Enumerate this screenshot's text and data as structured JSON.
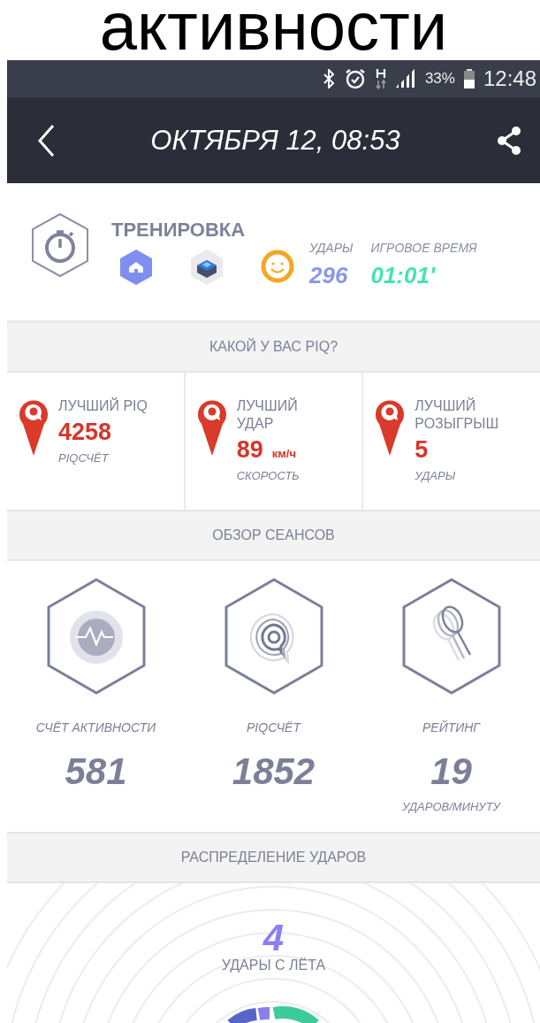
{
  "caption": "активности",
  "status_bar": {
    "battery": "33%",
    "time": "12:48"
  },
  "app_bar": {
    "title": "ОКТЯБРЯ 12, 08:53"
  },
  "workout": {
    "title": "ТРЕНИРОВКА",
    "stats": [
      {
        "label": "УДАРЫ",
        "value": "296",
        "color": "#8b98e6"
      },
      {
        "label": "ИГРОВОЕ ВРЕМЯ",
        "value": "01:01'",
        "color": "#45e3b4"
      }
    ]
  },
  "bests": {
    "header": "КАКОЙ У ВАС PIQ?",
    "items": [
      {
        "label": "ЛУЧШИЙ PIQ",
        "value": "4258",
        "caption": "PIQСЧЁТ"
      },
      {
        "label": "ЛУЧШИЙ УДАР",
        "value": "89",
        "unit": "км/ч",
        "caption": "СКОРОСТЬ"
      },
      {
        "label": "ЛУЧШИЙ РОЗЫГРЫШ",
        "value": "5",
        "caption": "УДАРЫ"
      }
    ]
  },
  "overview": {
    "header": "ОБЗОР СЕАНСОВ",
    "items": [
      {
        "kind": "activity",
        "label": "СЧЁТ АКТИВНОСТИ",
        "value": "581"
      },
      {
        "kind": "piq",
        "label": "PIQСЧЁТ",
        "value": "1852"
      },
      {
        "kind": "rating",
        "label": "РЕЙТИНГ",
        "value": "19",
        "sub": "УДАРОВ/МИНУТУ"
      }
    ]
  },
  "distribution": {
    "header": "РАСПРЕДЕЛЕНИЕ УДАРОВ",
    "value": "4",
    "label": "УДАРЫ С ЛЁТА"
  }
}
